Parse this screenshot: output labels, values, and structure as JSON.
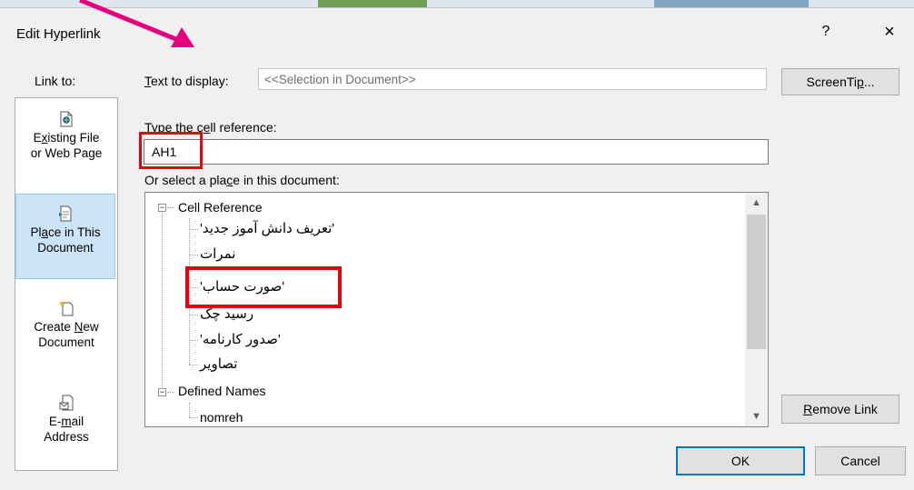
{
  "dialog": {
    "title": "Edit Hyperlink",
    "help_glyph": "?",
    "close_glyph": "×"
  },
  "link_to": {
    "label": "Link to:",
    "items": [
      {
        "line1_pre": "E",
        "line1_u": "x",
        "line1_post": "isting File",
        "line2": "or Web Page",
        "icon": "existing-file-icon"
      },
      {
        "line1_pre": "Pl",
        "line1_u": "a",
        "line1_post": "ce in This",
        "line2": "Document",
        "icon": "place-in-document-icon",
        "selected": true
      },
      {
        "line1": "Create ",
        "line1_u": "N",
        "line1_post": "ew",
        "line2": "Document",
        "icon": "create-new-document-icon"
      },
      {
        "line1_pre": "E-",
        "line1_u": "m",
        "line1_post": "ail",
        "line2": "Address",
        "icon": "email-address-icon"
      }
    ]
  },
  "text_to_display": {
    "label_u": "T",
    "label_rest": "ext to display:",
    "value": "<<Selection in Document>>"
  },
  "screentip_button": {
    "pre": "ScreenTi",
    "u": "p",
    "post": "..."
  },
  "cell_reference": {
    "label_pre": "Type the c",
    "label_u": "e",
    "label_post": "ll reference:",
    "value": "AH1"
  },
  "place_select": {
    "label_pre": "Or select a pla",
    "label_u": "c",
    "label_post": "e in this document:"
  },
  "tree": {
    "group1": {
      "label": "Cell Reference",
      "expander": "−"
    },
    "sheets": [
      "'تعریف دانش آموز جدید'",
      "نمرات",
      "'صورت حساب'",
      "رسید چک",
      "'صدور کارنامه'",
      "تصاویر"
    ],
    "group2": {
      "label": "Defined Names",
      "expander": "−"
    },
    "names": [
      "nomreh"
    ]
  },
  "scrollbar": {
    "up_glyph": "▲",
    "down_glyph": "▼"
  },
  "remove_link_button": {
    "u": "R",
    "rest": "emove Link"
  },
  "ok_button": "OK",
  "cancel_button": "Cancel",
  "colors": {
    "highlight": "#e8000b",
    "arrow": "#e6007e",
    "accent": "#0078d7"
  }
}
